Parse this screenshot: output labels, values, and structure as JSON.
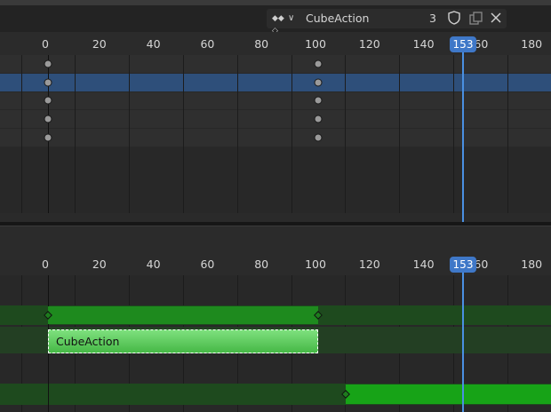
{
  "header": {
    "action_name": "CubeAction",
    "users_count": "3",
    "mode_icon": "keyframe-type-icon",
    "dropdown_icon": "chevron-down-icon",
    "fake_user_icon": "shield-icon",
    "duplicate_icon": "duplicate-icon",
    "unlink_icon": "close-icon"
  },
  "timeline_ticks": [
    "0",
    "20",
    "40",
    "60",
    "80",
    "100",
    "120",
    "140",
    "160",
    "180"
  ],
  "current_frame": "153",
  "top_editor": {
    "channel_rows": 5,
    "keyframe_frames": [
      0,
      100
    ]
  },
  "nla_editor": {
    "strip_label": "CubeAction",
    "strip_start": 0,
    "strip_end": 100
  },
  "colors": {
    "playhead": "#4a90e2",
    "strip_green": "#1e8a1e",
    "selected_row": "#2e4f7a"
  }
}
